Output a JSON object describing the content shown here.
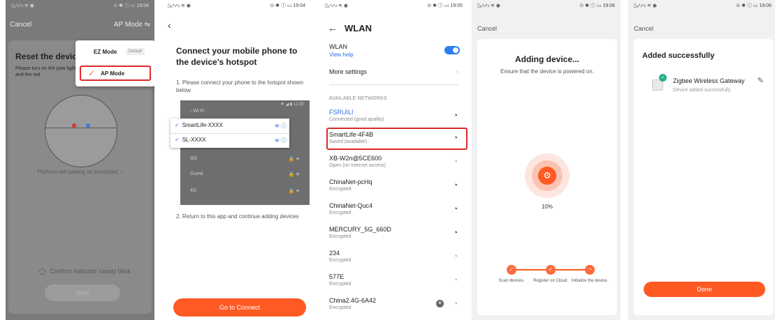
{
  "screen1": {
    "status_left": "▯ₐ⁴ᵢₗ⁴ᵢₗ ≋ ◉",
    "status_right": "⊙ ✱ ⓘ ▭ 19:04",
    "cancel": "Cancel",
    "mode": "AP Mode ⇋",
    "reset_title": "Reset the devic",
    "reset_desc": "Please turn on the pow light is on and the red",
    "perform": "Perform net pairing as prompted. ›",
    "confirm": "Confirm indicator slowly blink",
    "next": "Next",
    "menu": {
      "ez_mode": "EZ Mode",
      "default": "Default",
      "ap_mode": "AP Mode"
    }
  },
  "screen2": {
    "status_left": "▯ₐ⁴ᵢₗ⁴ᵢₗ ≋ ◉",
    "status_right": "⊙ ✱ ⓘ ▭ 19:04",
    "back": "‹",
    "title": "Connect your mobile phone to the device's hotspot",
    "step1": "1. Please connect your phone to the hotspot shown below",
    "mock": {
      "status": "▼ ◢ ▮ 12:30",
      "wifi_label": "‹  Wi-Fi",
      "rows": [
        "SG",
        "Guest",
        "4G"
      ],
      "popup": [
        "SmartLife-XXXX",
        "SL-XXXX"
      ]
    },
    "step2": "2. Return to this app and continue adding devices",
    "go": "Go to Connect"
  },
  "screen3": {
    "status_left": "▯ₐ⁴ᵢₗ⁴ᵢₗ ≋ ◉",
    "status_right": "⊙ ✱ ⓘ ▭ 19:05",
    "title": "WLAN",
    "wlan": "WLAN",
    "view_help": "View help",
    "more": "More settings",
    "available": "AVAILABLE NETWORKS",
    "networks": [
      {
        "name": "FSRUILI",
        "status": "Connected (good quality)"
      },
      {
        "name": "SmartLife-4F4B",
        "status": "Saved (available)"
      },
      {
        "name": "XB-W2n@5CE600",
        "status": "Open (no Internet access)"
      },
      {
        "name": "ChinaNet-pcHq",
        "status": "Encrypted"
      },
      {
        "name": "ChinaNet-Quc4",
        "status": "Encrypted"
      },
      {
        "name": "MERCURY_5G_660D",
        "status": "Encrypted"
      },
      {
        "name": "234",
        "status": "Encrypted"
      },
      {
        "name": "577E",
        "status": "Encrypted"
      },
      {
        "name": "China2.4G-6A42",
        "status": "Encrypted"
      }
    ]
  },
  "screen4": {
    "status_left": "▯ₐ⁴ᵢₗ⁴ᵢₗ ≋ ◉",
    "status_right": "⊙ ✱ ⓘ ▭ 19:06",
    "cancel": "Cancel",
    "title": "Adding device...",
    "subtitle": "Ensure that the device is powered on.",
    "percent": "10%",
    "steps": [
      "Scan devices.",
      "Register on Cloud.",
      "Initialize the device."
    ]
  },
  "screen5": {
    "status_left": "▯ₐ⁴ᵢₗ⁴ᵢₗ ≋ ◉",
    "status_right": "⊙ ✱ ⓘ ▭ 19:06",
    "cancel": "Cancel",
    "title": "Added successfully",
    "device_name": "Zigbee Wireless Gateway",
    "device_status": "Device added successfully",
    "done": "Done"
  },
  "colors": {
    "accent": "#ff5a24",
    "highlight": "#e02828",
    "link": "#2a6ee6",
    "success": "#22b08a"
  }
}
